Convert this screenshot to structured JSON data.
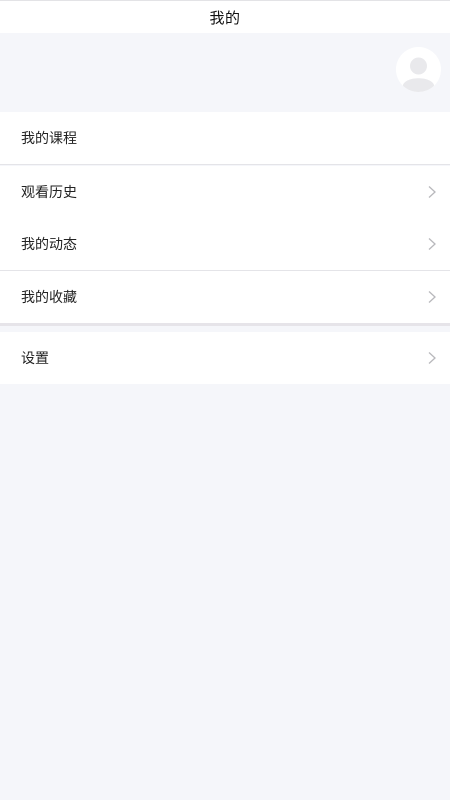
{
  "header": {
    "title": "我的"
  },
  "profile": {
    "avatar_icon": "default-user-avatar-icon"
  },
  "menu": {
    "my_courses": "我的课程",
    "watch_history": "观看历史",
    "my_updates": "我的动态",
    "my_favorites": "我的收藏",
    "settings": "设置"
  },
  "icons": {
    "chevron": "chevron-right-icon"
  },
  "colors": {
    "background": "#f5f6fa",
    "card": "#ffffff",
    "divider": "#e4e4e8",
    "chevron": "#b8b8bc"
  }
}
